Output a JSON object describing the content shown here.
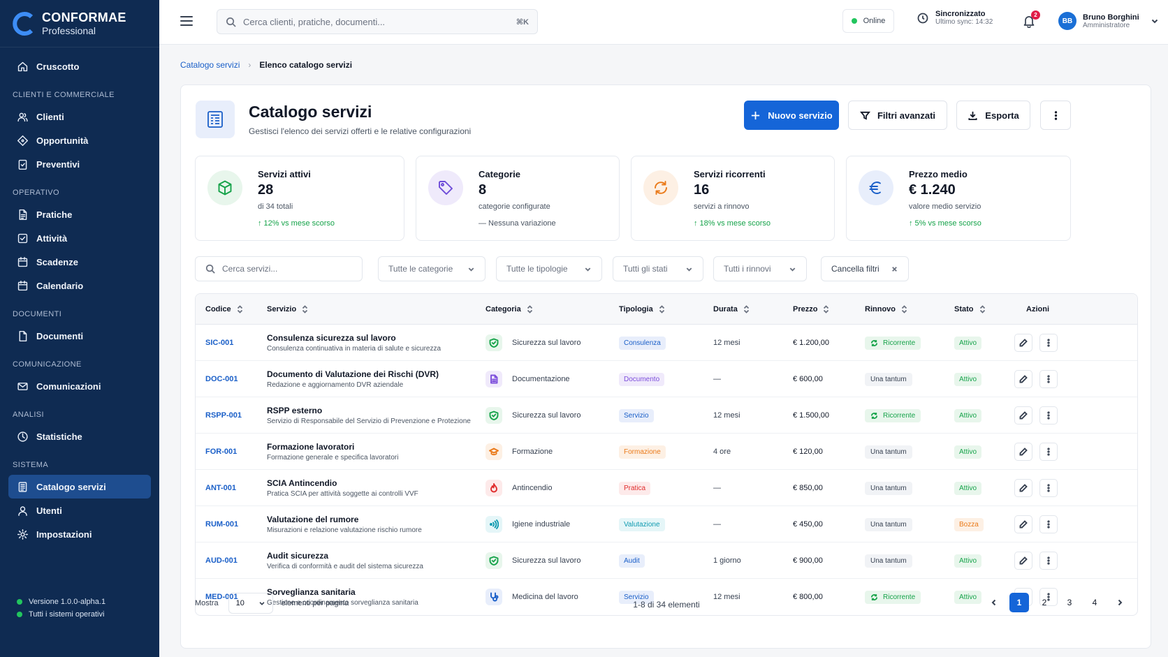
{
  "brand": {
    "name": "CONFORMAE",
    "edition": "Professional"
  },
  "sidebar": {
    "items": [
      {
        "label": "Cruscotto",
        "icon": "home-icon"
      },
      {
        "section": "Clienti e commerciale"
      },
      {
        "label": "Clienti",
        "icon": "users-icon"
      },
      {
        "label": "Opportunità",
        "icon": "diamond-icon"
      },
      {
        "label": "Preventivi",
        "icon": "clipboard-check-icon"
      },
      {
        "section": "Operativo"
      },
      {
        "label": "Pratiche",
        "icon": "file-text-icon"
      },
      {
        "label": "Attività",
        "icon": "checkbox-icon"
      },
      {
        "label": "Scadenze",
        "icon": "calendar-icon"
      },
      {
        "label": "Calendario",
        "icon": "calendar-icon"
      },
      {
        "section": "Documenti"
      },
      {
        "label": "Documenti",
        "icon": "file-icon"
      },
      {
        "section": "Comunicazione"
      },
      {
        "label": "Comunicazioni",
        "icon": "mail-icon"
      },
      {
        "section": "Analisi"
      },
      {
        "label": "Statistiche",
        "icon": "chart-icon"
      },
      {
        "section": "Sistema"
      },
      {
        "label": "Catalogo servizi",
        "icon": "catalog-icon",
        "active": true
      },
      {
        "label": "Utenti",
        "icon": "user-icon"
      },
      {
        "label": "Impostazioni",
        "icon": "gear-icon"
      }
    ],
    "footer": {
      "version": "Versione 1.0.0-alpha.1",
      "status": "Tutti i sistemi operativi"
    }
  },
  "topbar": {
    "search_placeholder": "Cerca clienti, pratiche, documenti...",
    "search_shortcut": "⌘K",
    "online_label": "Online",
    "sync_title": "Sincronizzato",
    "sync_sub": "Ultimo sync: 14:32",
    "notifications_count": "2",
    "user_initials": "BB",
    "user_name": "Bruno Borghini",
    "user_role": "Amministratore"
  },
  "breadcrumb": {
    "parent": "Catalogo servizi",
    "current": "Elenco catalogo servizi"
  },
  "page": {
    "title": "Catalogo servizi",
    "subtitle": "Gestisci l'elenco dei servizi offerti e le relative configurazioni",
    "new_button": "Nuovo servizio",
    "filters_button": "Filtri avanzati",
    "export_button": "Esporta"
  },
  "stats": [
    {
      "label": "Servizi attivi",
      "value": "28",
      "sub": "di 34 totali",
      "trend": "↑ 12% vs mese scorso",
      "icon": "box-icon",
      "color": "#16a34a",
      "bg": "#e8f6ec"
    },
    {
      "label": "Categorie",
      "value": "8",
      "sub": "categorie configurate",
      "trend": "— Nessuna variazione",
      "icon": "tag-icon",
      "color": "#6d4bd8",
      "bg": "#efeafb",
      "neutral": true
    },
    {
      "label": "Servizi ricorrenti",
      "value": "16",
      "sub": "servizi a rinnovo",
      "trend": "↑ 18% vs mese scorso",
      "icon": "refresh-icon",
      "color": "#ea7a1a",
      "bg": "#fdf0e4"
    },
    {
      "label": "Prezzo medio",
      "value": "€ 1.240",
      "sub": "valore medio servizio",
      "trend": "↑ 5% vs mese scorso",
      "icon": "euro-icon",
      "color": "#1a5fc8",
      "bg": "#e8eefb"
    }
  ],
  "filters": {
    "search_placeholder": "Cerca servizi...",
    "category": "Tutte le categorie",
    "type": "Tutte le tipologie",
    "status": "Tutti gli stati",
    "renewal": "Tutti i rinnovi",
    "clear": "Cancella filtri"
  },
  "table": {
    "headers": {
      "code": "Codice",
      "service": "Servizio",
      "category": "Categoria",
      "type": "Tipologia",
      "duration": "Durata",
      "price": "Prezzo",
      "renewal": "Rinnovo",
      "status": "Stato",
      "actions": "Azioni"
    },
    "rows": [
      {
        "code": "SIC-001",
        "name": "Consulenza sicurezza sul lavoro",
        "desc": "Consulenza continuativa in materia di salute e sicurezza",
        "category": "Sicurezza sul lavoro",
        "cat_icon": "shield-check-icon",
        "type": "Consulenza",
        "duration": "12 mesi",
        "price": "€ 1.200,00",
        "renewal": "Ricorrente",
        "status": "Attivo"
      },
      {
        "code": "DOC-001",
        "name": "Documento di Valutazione dei Rischi (DVR)",
        "desc": "Redazione e aggiornamento DVR aziendale",
        "category": "Documentazione",
        "cat_icon": "document-icon",
        "type": "Documento",
        "duration": "—",
        "price": "€ 600,00",
        "renewal": "Una tantum",
        "status": "Attivo"
      },
      {
        "code": "RSPP-001",
        "name": "RSPP esterno",
        "desc": "Servizio di Responsabile del Servizio di Prevenzione e Protezione",
        "category": "Sicurezza sul lavoro",
        "cat_icon": "shield-check-icon",
        "type": "Servizio",
        "duration": "12 mesi",
        "price": "€ 1.500,00",
        "renewal": "Ricorrente",
        "status": "Attivo"
      },
      {
        "code": "FOR-001",
        "name": "Formazione lavoratori",
        "desc": "Formazione generale e specifica lavoratori",
        "category": "Formazione",
        "cat_icon": "graduation-cap-icon",
        "type": "Formazione",
        "duration": "4 ore",
        "price": "€ 120,00",
        "renewal": "Una tantum",
        "status": "Attivo"
      },
      {
        "code": "ANT-001",
        "name": "SCIA Antincendio",
        "desc": "Pratica SCIA per attività soggette ai controlli VVF",
        "category": "Antincendio",
        "cat_icon": "flame-icon",
        "type": "Pratica",
        "duration": "—",
        "price": "€ 850,00",
        "renewal": "Una tantum",
        "status": "Attivo"
      },
      {
        "code": "RUM-001",
        "name": "Valutazione del rumore",
        "desc": "Misurazioni e relazione valutazione rischio rumore",
        "category": "Igiene industriale",
        "cat_icon": "sound-wave-icon",
        "type": "Valutazione",
        "duration": "—",
        "price": "€ 450,00",
        "renewal": "Una tantum",
        "status": "Bozza"
      },
      {
        "code": "AUD-001",
        "name": "Audit sicurezza",
        "desc": "Verifica di conformità e audit del sistema sicurezza",
        "category": "Sicurezza sul lavoro",
        "cat_icon": "shield-check-icon",
        "type": "Audit",
        "duration": "1 giorno",
        "price": "€ 900,00",
        "renewal": "Una tantum",
        "status": "Attivo"
      },
      {
        "code": "MED-001",
        "name": "Sorveglianza sanitaria",
        "desc": "Gestione e coordinamento sorveglianza sanitaria",
        "category": "Medicina del lavoro",
        "cat_icon": "stethoscope-icon",
        "type": "Servizio",
        "duration": "12 mesi",
        "price": "€ 800,00",
        "renewal": "Ricorrente",
        "status": "Attivo"
      }
    ]
  },
  "footer": {
    "show_label": "Mostra",
    "per_page": "10",
    "per_page_label": "elementi per pagina",
    "range": "1-8 di 34 elementi",
    "pages": [
      "1",
      "2",
      "3",
      "4"
    ],
    "current_page": "1"
  }
}
